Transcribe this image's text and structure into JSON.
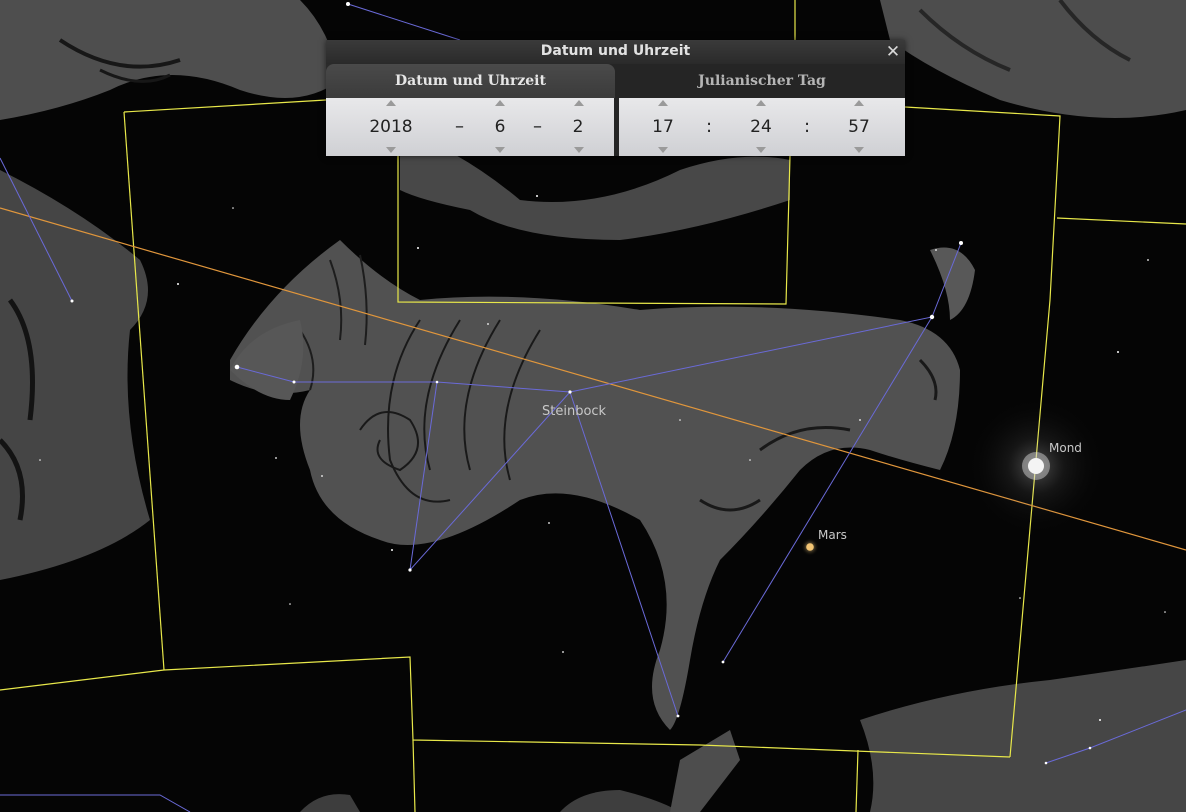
{
  "dialog": {
    "title": "Datum und Uhrzeit",
    "close_icon": "close-icon",
    "tabs": [
      {
        "label": "Datum und Uhrzeit",
        "active": true
      },
      {
        "label": "Julianischer Tag",
        "active": false
      }
    ],
    "date": {
      "year": "2018",
      "month": "6",
      "day": "2",
      "separator": "–"
    },
    "time": {
      "hour": "17",
      "minute": "24",
      "second": "57",
      "separator": ":"
    }
  },
  "sky": {
    "constellation_label": "Steinbock",
    "planet_label": "Mars",
    "moon_label": "Mond",
    "colors": {
      "boundary": "#e8e84a",
      "ecliptic": "#e0963c",
      "constellation_lines": "#6a6ad8",
      "mars": "#f2c473",
      "moon": "#f4f4f4"
    }
  }
}
